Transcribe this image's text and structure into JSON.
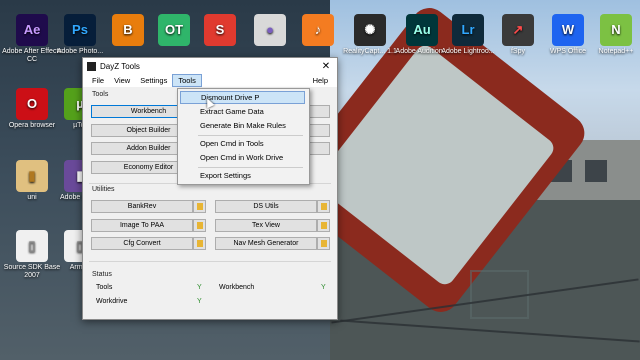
{
  "desktop_icons": [
    {
      "label": "Adobe After Effects CC",
      "glyph": "Ae",
      "color": "#1f0b4c",
      "text_color": "#c89bff"
    },
    {
      "label": "Adobe Photo...",
      "glyph": "Ps",
      "color": "#061e3a",
      "text_color": "#31a8ff"
    },
    {
      "label": "",
      "glyph": "B",
      "color": "#e87d0d",
      "text_color": "#ffffff"
    },
    {
      "label": "",
      "glyph": "OT",
      "color": "#2fb56a",
      "text_color": "#ffffff"
    },
    {
      "label": "",
      "glyph": "S",
      "color": "#e03a2f",
      "text_color": "#ffffff"
    },
    {
      "label": "",
      "glyph": "●",
      "color": "#d9d9d9",
      "text_color": "#7b5fbf"
    },
    {
      "label": "",
      "glyph": "♪",
      "color": "#f47c21",
      "text_color": "#ffffff"
    },
    {
      "label": "RealityCapt... 1.1",
      "glyph": "✺",
      "color": "#2a2a2a",
      "text_color": "#ffffff"
    },
    {
      "label": "Adobe Audition...",
      "glyph": "Au",
      "color": "#00363a",
      "text_color": "#9affea"
    },
    {
      "label": "Adobe Lightroo...",
      "glyph": "Lr",
      "color": "#0f2a3b",
      "text_color": "#31a8ff"
    },
    {
      "label": "fSpy",
      "glyph": "↗",
      "color": "#3a3a3a",
      "text_color": "#ff4b4b"
    },
    {
      "label": "WPS Office",
      "glyph": "W",
      "color": "#1e64f0",
      "text_color": "#ffffff"
    },
    {
      "label": "Notepad++",
      "glyph": "N",
      "color": "#7cc143",
      "text_color": "#ffffff"
    },
    {
      "label": "Opera browser",
      "glyph": "O",
      "color": "#cc0f16",
      "text_color": "#ffffff"
    },
    {
      "label": "µTor",
      "glyph": "µ",
      "color": "#54a11b",
      "text_color": "#ffffff"
    },
    {
      "label": "uni",
      "glyph": "▮",
      "color": "#e0c080",
      "text_color": "#b07820"
    },
    {
      "label": "Adobe Effect",
      "glyph": "▮",
      "color": "#6a4a9a",
      "text_color": "#ffffff"
    },
    {
      "label": "Source SDK Base 2007",
      "glyph": "▯",
      "color": "#f0f0f0",
      "text_color": "#888888"
    },
    {
      "label": "Arma3",
      "glyph": "▯",
      "color": "#f0f0f0",
      "text_color": "#888888"
    }
  ],
  "dialog": {
    "title": "DayZ Tools",
    "close_glyph": "✕",
    "menu": {
      "file": "File",
      "view": "View",
      "settings": "Settings",
      "tools": "Tools",
      "help": "Help"
    },
    "tools_group": {
      "label": "Tools",
      "buttons": [
        "Workbench",
        "Object Builder",
        "Addon Builder",
        "Economy Editor"
      ]
    },
    "utilities_group": {
      "label": "Utilities",
      "left_buttons": [
        "BankRev",
        "Image To PAA",
        "Cfg Convert"
      ],
      "right_buttons": [
        "DS Utils",
        "Tex View",
        "Nav Mesh Generator"
      ]
    },
    "status_group": {
      "label": "Status",
      "rows": [
        {
          "name": "Tools",
          "value": "Y"
        },
        {
          "name": "Workdrive",
          "value": "Y"
        }
      ],
      "right_rows": [
        {
          "name": "Workbench",
          "value": "Y"
        }
      ]
    }
  },
  "tools_menu": {
    "items": [
      "Dismount Drive P",
      "Extract Game Data",
      "Generate Bin Make Rules",
      "Open Cmd in Tools",
      "Open Cmd in Work Drive",
      "Export Settings"
    ],
    "highlighted_index": 0
  }
}
